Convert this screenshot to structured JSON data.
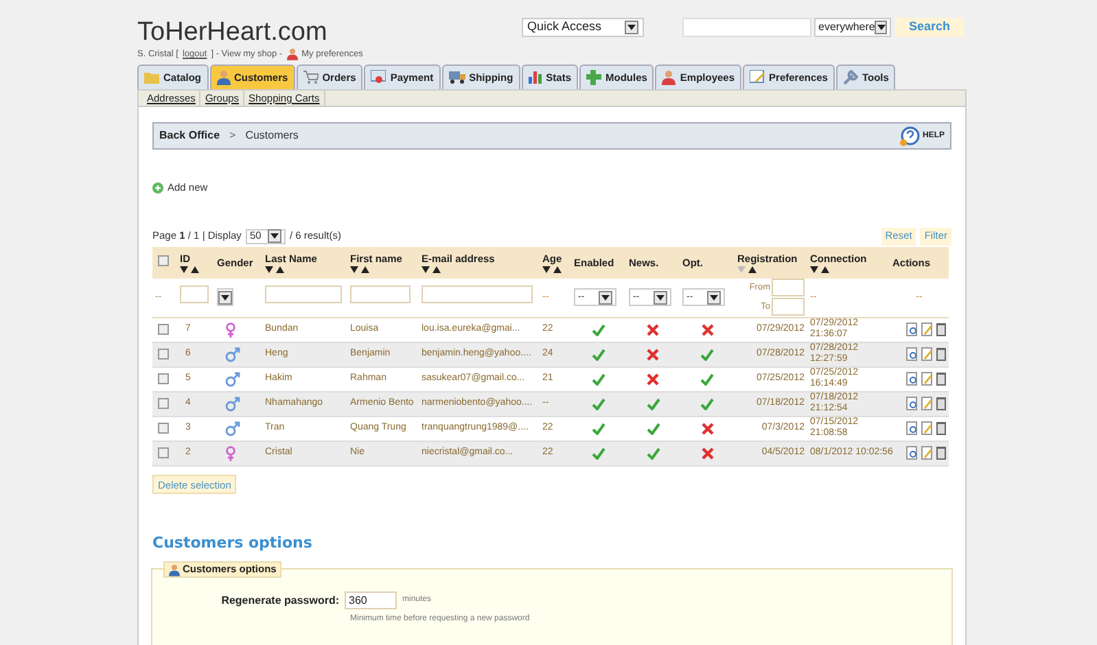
{
  "header": {
    "site_title": "ToHerHeart.com",
    "quick_access": "Quick Access",
    "search_scope": "everywhere",
    "search_button": "Search",
    "user": "S. Cristal [",
    "logout": "logout",
    "after_logout": "] - View my shop -",
    "preferences": "My preferences"
  },
  "tabs": [
    {
      "label": "Catalog",
      "selected": false
    },
    {
      "label": "Customers",
      "selected": true
    },
    {
      "label": "Orders",
      "selected": false
    },
    {
      "label": "Payment",
      "selected": false
    },
    {
      "label": "Shipping",
      "selected": false
    },
    {
      "label": "Stats",
      "selected": false
    },
    {
      "label": "Modules",
      "selected": false
    },
    {
      "label": "Employees",
      "selected": false
    },
    {
      "label": "Preferences",
      "selected": false
    },
    {
      "label": "Tools",
      "selected": false
    }
  ],
  "subtabs": [
    "Addresses",
    "Groups",
    "Shopping Carts"
  ],
  "breadcrumb": {
    "root": "Back Office",
    "separator": ">",
    "current": "Customers",
    "help": "HELP"
  },
  "add_new": "Add new",
  "pagination": {
    "page_label": "Page",
    "page": "1",
    "total": "/ 1 | Display",
    "per_page": "50",
    "results": "/ 6 result(s)",
    "reset": "Reset",
    "filter": "Filter"
  },
  "table": {
    "select_all_checked": false,
    "columns": [
      {
        "label": "ID",
        "sorted": false
      },
      {
        "label": "Gender"
      },
      {
        "label": "Last Name",
        "sorted": false
      },
      {
        "label": "First name",
        "sorted": false
      },
      {
        "label": "E-mail address",
        "sorted": false
      },
      {
        "label": "Age",
        "sorted": false
      },
      {
        "label": "Enabled"
      },
      {
        "label": "News."
      },
      {
        "label": "Opt."
      },
      {
        "label": "Registration",
        "sorted": true
      },
      {
        "label": "Connection",
        "sorted": false
      },
      {
        "label": "Actions"
      }
    ],
    "filters": {
      "placeholder_dash": "--",
      "select_value": "--",
      "from": "From",
      "to": "To"
    },
    "rows": [
      {
        "checked": false,
        "id": "7",
        "kind": "female",
        "last": "Bundan",
        "first": "Louisa",
        "email": "lou.isa.eureka@gmai...",
        "age": "22",
        "enabled": true,
        "news": false,
        "opt": false,
        "registration": "07/29/2012",
        "connection": [
          "07/29/2012",
          "21:36:07"
        ]
      },
      {
        "checked": false,
        "id": "6",
        "kind": "male",
        "last": "Heng",
        "first": "Benjamin",
        "email": "benjamin.heng@yahoo....",
        "age": "24",
        "enabled": true,
        "news": false,
        "opt": true,
        "registration": "07/28/2012",
        "connection": [
          "07/28/2012",
          "12:27:59"
        ]
      },
      {
        "checked": false,
        "id": "5",
        "kind": "male",
        "last": "Hakim",
        "first": "Rahman",
        "email": "sasukear07@gmail.co...",
        "age": "21",
        "enabled": true,
        "news": false,
        "opt": true,
        "registration": "07/25/2012",
        "connection": [
          "07/25/2012",
          "16:14:49"
        ]
      },
      {
        "checked": false,
        "id": "4",
        "kind": "male",
        "last": "Nhamahango",
        "first": "Armenio Bento",
        "email": "narmeniobento@yahoo....",
        "age": "--",
        "enabled": true,
        "news": true,
        "opt": true,
        "registration": "07/18/2012",
        "connection": [
          "07/18/2012",
          "21:12:54"
        ]
      },
      {
        "checked": false,
        "id": "3",
        "kind": "male",
        "last": "Tran",
        "first": "Quang Trung",
        "email": "tranquangtrung1989@....",
        "age": "22",
        "enabled": true,
        "news": true,
        "opt": false,
        "registration": "07/3/2012",
        "connection": [
          "07/15/2012",
          "21:08:58"
        ]
      },
      {
        "checked": false,
        "id": "2",
        "kind": "female",
        "last": "Cristal",
        "first": "Nie",
        "email": "niecristal@gmail.co...",
        "age": "22",
        "enabled": true,
        "news": true,
        "opt": false,
        "registration": "04/5/2012",
        "connection": [
          "08/1/2012 10:02:56"
        ]
      }
    ]
  },
  "delete_selection": "Delete selection",
  "options": {
    "title": "Customers options",
    "legend": "Customers options",
    "field_label": "Regenerate password:",
    "field_value": "360",
    "unit": "minutes",
    "hint": "Minimum time before requesting a new password"
  }
}
